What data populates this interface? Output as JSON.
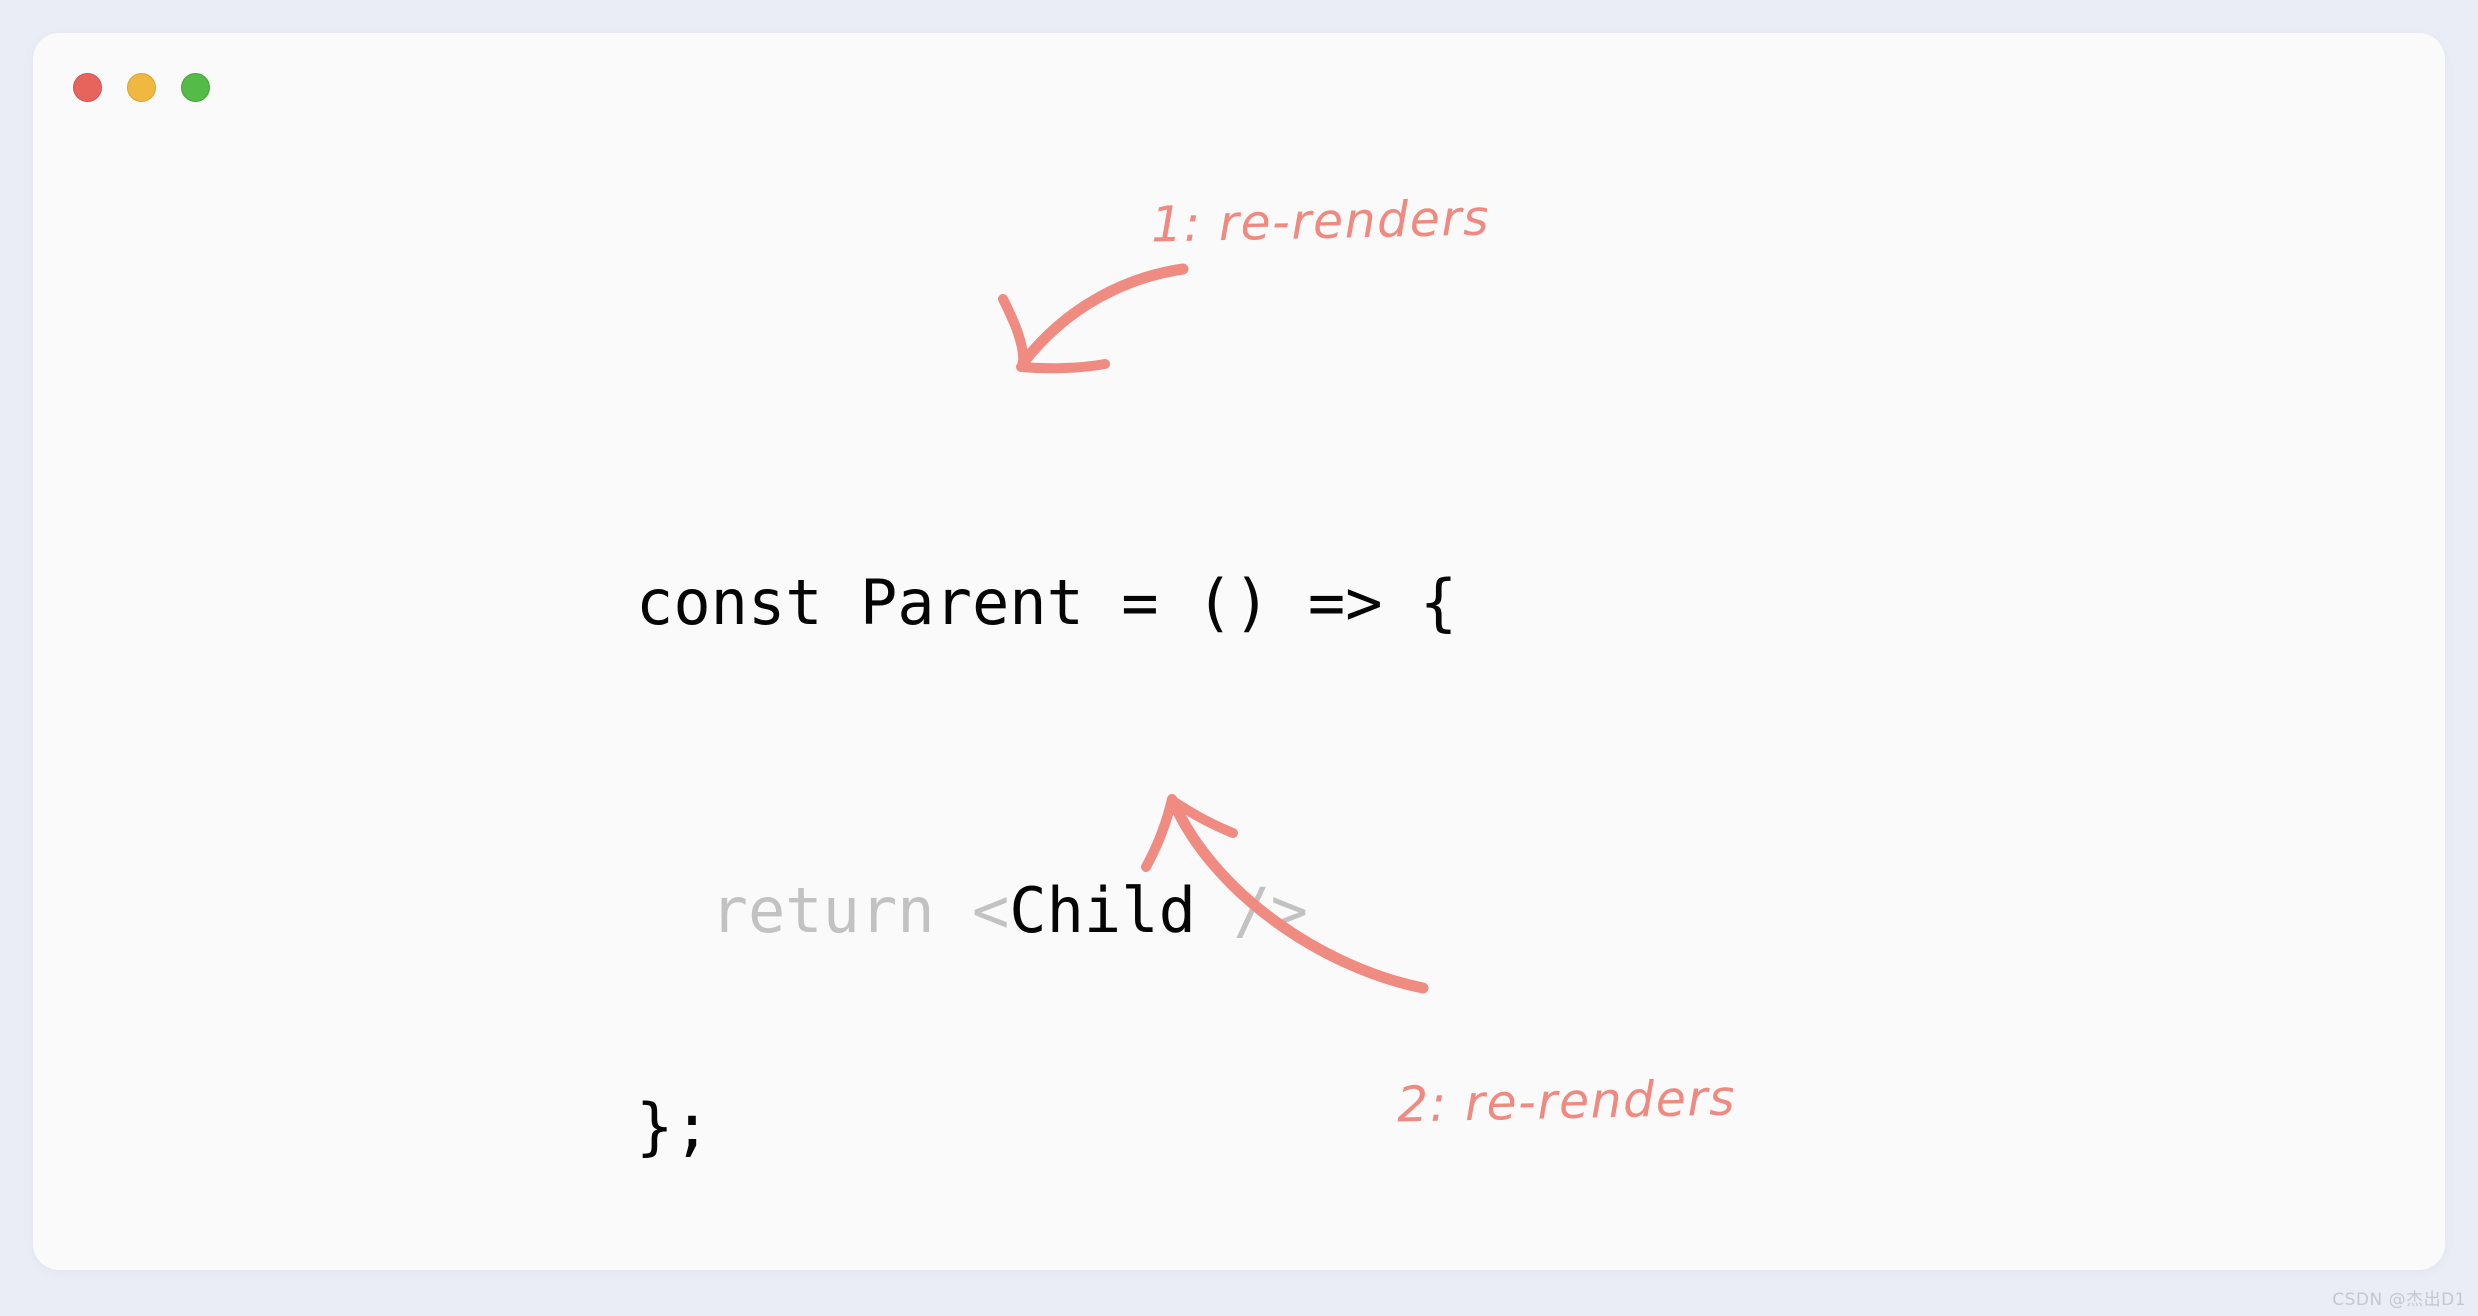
{
  "window": {
    "traffic_lights": [
      {
        "name": "close",
        "color": "#e8635c"
      },
      {
        "name": "minimize",
        "color": "#f0b840"
      },
      {
        "name": "maximize",
        "color": "#53bb46"
      }
    ],
    "background_color": "#fafafa",
    "page_background_color": "#eaedf5"
  },
  "code": {
    "language": "jsx",
    "line1": "const Parent = () => {",
    "line2_indent": "  ",
    "line2_keyword": "return",
    "line2_space": " ",
    "line2_open": "<",
    "line2_component": "Child",
    "line2_close": " />",
    "line3": "};",
    "keyword_color": "#c2c2c2",
    "punctuation_color": "#c2c2c2",
    "component_color": "#050505"
  },
  "annotations": [
    {
      "id": 1,
      "label": "1: re-renders",
      "color": "#f08a80",
      "points_to": "const Parent"
    },
    {
      "id": 2,
      "label": "2: re-renders",
      "color": "#f08a80",
      "points_to": "<Child />"
    }
  ],
  "watermark": {
    "text": "CSDN @杰出D1"
  }
}
